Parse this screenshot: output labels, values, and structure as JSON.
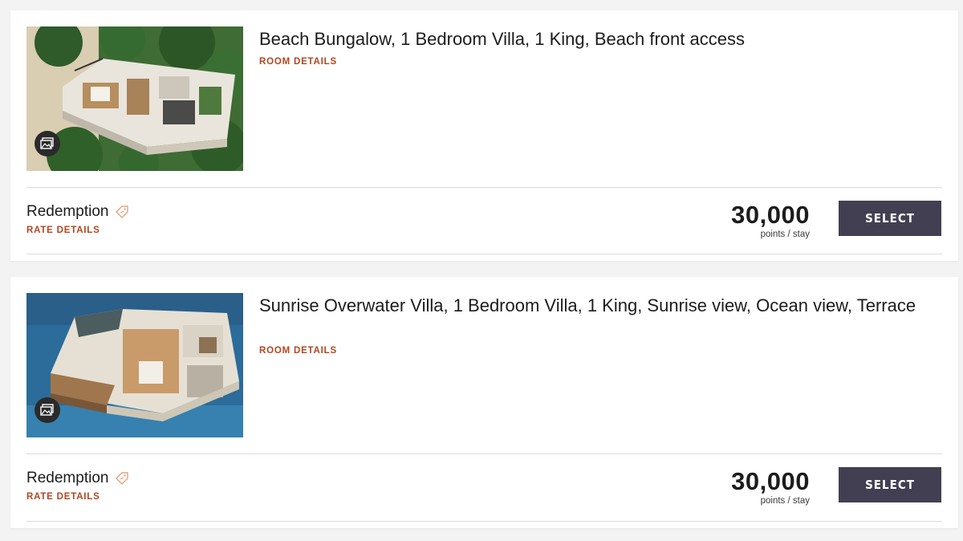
{
  "rooms": [
    {
      "title": "Beach Bungalow, 1 Bedroom Villa, 1 King, Beach front access",
      "room_details_label": "ROOM DETAILS",
      "image_icon": "gallery-icon",
      "rate": {
        "name": "Redemption",
        "tag_icon": "tag-icon",
        "rate_details_label": "RATE DETAILS",
        "points": "30,000",
        "points_unit": "points / stay",
        "select_label": "SELECT"
      }
    },
    {
      "title": "Sunrise Overwater Villa, 1 Bedroom Villa, 1 King, Sunrise view, Ocean view, Terrace",
      "room_details_label": "ROOM DETAILS",
      "image_icon": "gallery-icon",
      "rate": {
        "name": "Redemption",
        "tag_icon": "tag-icon",
        "rate_details_label": "RATE DETAILS",
        "points": "30,000",
        "points_unit": "points / stay",
        "select_label": "SELECT"
      }
    }
  ],
  "colors": {
    "page_bg": "#f3f3f3",
    "card_bg": "#ffffff",
    "link_accent": "#b2461f",
    "select_button_bg": "#433f52",
    "tag_icon": "#e8a07a"
  }
}
